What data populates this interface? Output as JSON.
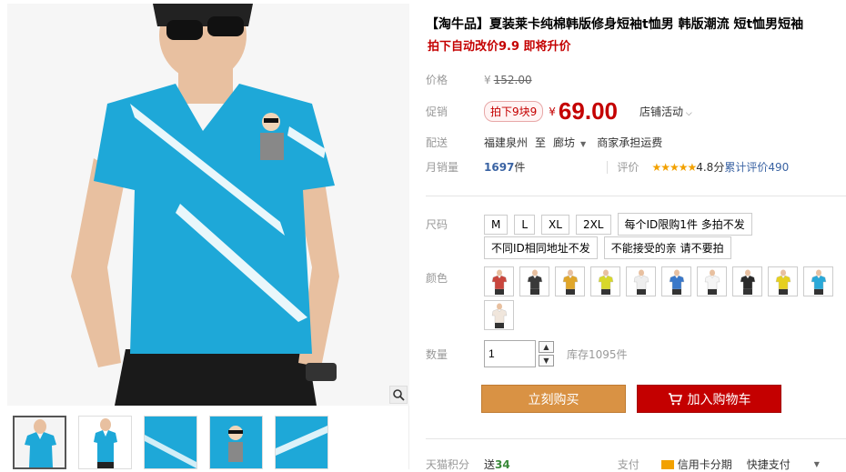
{
  "product": {
    "title": "【淘牛品】夏装莱卡纯棉韩版修身短袖t恤男 韩版潮流 短t恤男短袖",
    "subtitle": "拍下自动改价9.9 即将升价"
  },
  "price": {
    "label": "价格",
    "currency": "¥",
    "original": "152.00"
  },
  "promo": {
    "label": "促销",
    "tag": "拍下9块9",
    "currency": "¥",
    "price": "69.00",
    "store_activity": "店铺活动"
  },
  "shipping": {
    "label": "配送",
    "from": "福建泉州",
    "to_word": "至",
    "to": "廊坊",
    "note": "商家承担运费"
  },
  "sales": {
    "label": "月销量",
    "count": "1697",
    "unit": "件",
    "review_label": "评价",
    "stars": "★★★★★",
    "score": "4.8分",
    "review_link": "累计评价490"
  },
  "size": {
    "label": "尺码",
    "options": [
      "M",
      "L",
      "XL",
      "2XL",
      "每个ID限购1件 多拍不发"
    ],
    "options2": [
      "不同ID相同地址不发",
      "不能接受的亲 请不要拍"
    ]
  },
  "color": {
    "label": "颜色",
    "swatches": [
      "#c9463d",
      "#3a3a3a",
      "#e0a62a",
      "#d8d82a",
      "#eeeeee",
      "#3a78c9",
      "#f5f5f5",
      "#2a2a2a",
      "#e6d020",
      "#2aa8d8",
      "#f0e6dc"
    ]
  },
  "quantity": {
    "label": "数量",
    "value": "1",
    "stock": "库存1095件"
  },
  "actions": {
    "buy_now": "立刻购买",
    "add_cart": "加入购物车"
  },
  "footer": {
    "points_label": "天猫积分",
    "points_text": "送",
    "points_value": "34",
    "pay_label": "支付",
    "credit": "信用卡分期",
    "quick_pay": "快捷支付"
  },
  "colors": {
    "accent_red": "#c40000",
    "buy_orange": "#d99244",
    "tshirt_blue": "#1ea8d8"
  }
}
